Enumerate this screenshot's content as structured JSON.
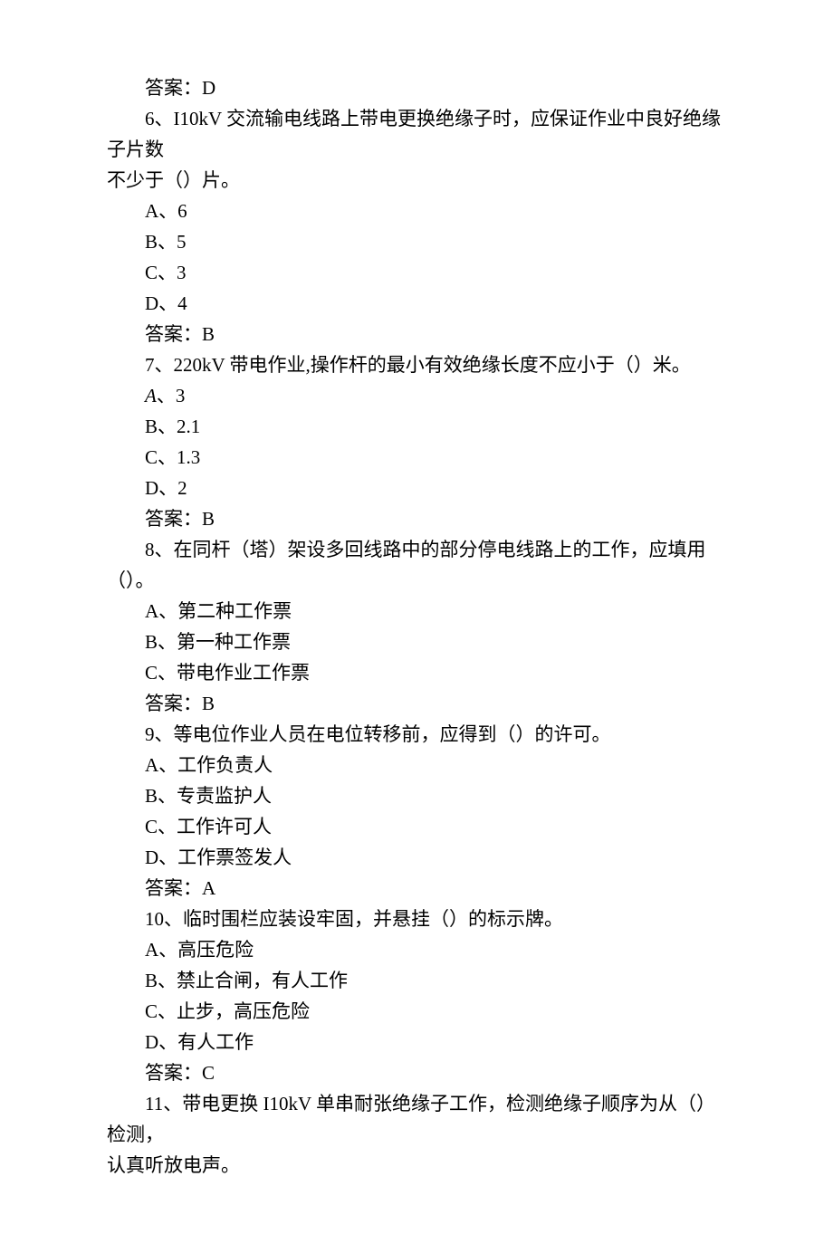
{
  "lines": {
    "l1": "答案：D",
    "l2": "6、I10kV 交流输电线路上带电更换绝缘子时，应保证作业中良好绝缘子片数",
    "l3": "不少于（）片。",
    "l4": "A、6",
    "l5": "B、5",
    "l6": "C、3",
    "l7": "D、4",
    "l8": "答案：B",
    "l9": "7、220kV 带电作业,操作杆的最小有效绝缘长度不应小于（）米。",
    "l10a": "A",
    "l10b": "、3",
    "l11": "B、2.1",
    "l12": "C、1.3",
    "l13": "D、2",
    "l14": "答案：B",
    "l15": "8、在同杆（塔）架设多回线路中的部分停电线路上的工作，应填用（）。",
    "l16": "A、第二种工作票",
    "l17": "B、第一种工作票",
    "l18": "C、带电作业工作票",
    "l19": "答案：B",
    "l20": "9、等电位作业人员在电位转移前，应得到（）的许可。",
    "l21": "A、工作负责人",
    "l22": "B、专责监护人",
    "l23": "C、工作许可人",
    "l24": "D、工作票签发人",
    "l25": "答案：A",
    "l26": "10、临时围栏应装设牢固，并悬挂（）的标示牌。",
    "l27": "A、高压危险",
    "l28": "B、禁止合闸，有人工作",
    "l29": "C、止步，高压危险",
    "l30": "D、有人工作",
    "l31": "答案：C",
    "l32": "11、带电更换 I10kV 单串耐张绝缘子工作，检测绝缘子顺序为从（）检测，",
    "l33": "认真听放电声。"
  }
}
